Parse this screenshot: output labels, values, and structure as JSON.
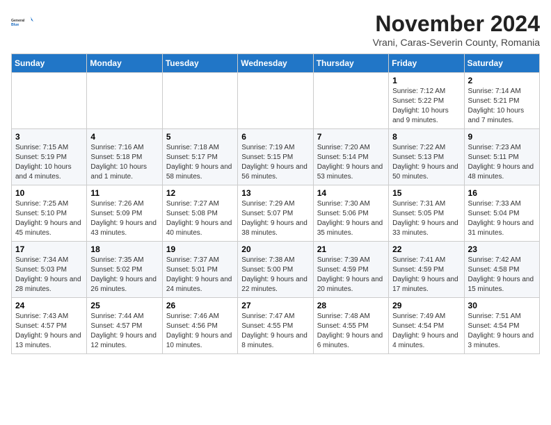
{
  "logo": {
    "general": "General",
    "blue": "Blue"
  },
  "title": "November 2024",
  "subtitle": "Vrani, Caras-Severin County, Romania",
  "days_header": [
    "Sunday",
    "Monday",
    "Tuesday",
    "Wednesday",
    "Thursday",
    "Friday",
    "Saturday"
  ],
  "weeks": [
    [
      {
        "day": "",
        "info": ""
      },
      {
        "day": "",
        "info": ""
      },
      {
        "day": "",
        "info": ""
      },
      {
        "day": "",
        "info": ""
      },
      {
        "day": "",
        "info": ""
      },
      {
        "day": "1",
        "info": "Sunrise: 7:12 AM\nSunset: 5:22 PM\nDaylight: 10 hours and 9 minutes."
      },
      {
        "day": "2",
        "info": "Sunrise: 7:14 AM\nSunset: 5:21 PM\nDaylight: 10 hours and 7 minutes."
      }
    ],
    [
      {
        "day": "3",
        "info": "Sunrise: 7:15 AM\nSunset: 5:19 PM\nDaylight: 10 hours and 4 minutes."
      },
      {
        "day": "4",
        "info": "Sunrise: 7:16 AM\nSunset: 5:18 PM\nDaylight: 10 hours and 1 minute."
      },
      {
        "day": "5",
        "info": "Sunrise: 7:18 AM\nSunset: 5:17 PM\nDaylight: 9 hours and 58 minutes."
      },
      {
        "day": "6",
        "info": "Sunrise: 7:19 AM\nSunset: 5:15 PM\nDaylight: 9 hours and 56 minutes."
      },
      {
        "day": "7",
        "info": "Sunrise: 7:20 AM\nSunset: 5:14 PM\nDaylight: 9 hours and 53 minutes."
      },
      {
        "day": "8",
        "info": "Sunrise: 7:22 AM\nSunset: 5:13 PM\nDaylight: 9 hours and 50 minutes."
      },
      {
        "day": "9",
        "info": "Sunrise: 7:23 AM\nSunset: 5:11 PM\nDaylight: 9 hours and 48 minutes."
      }
    ],
    [
      {
        "day": "10",
        "info": "Sunrise: 7:25 AM\nSunset: 5:10 PM\nDaylight: 9 hours and 45 minutes."
      },
      {
        "day": "11",
        "info": "Sunrise: 7:26 AM\nSunset: 5:09 PM\nDaylight: 9 hours and 43 minutes."
      },
      {
        "day": "12",
        "info": "Sunrise: 7:27 AM\nSunset: 5:08 PM\nDaylight: 9 hours and 40 minutes."
      },
      {
        "day": "13",
        "info": "Sunrise: 7:29 AM\nSunset: 5:07 PM\nDaylight: 9 hours and 38 minutes."
      },
      {
        "day": "14",
        "info": "Sunrise: 7:30 AM\nSunset: 5:06 PM\nDaylight: 9 hours and 35 minutes."
      },
      {
        "day": "15",
        "info": "Sunrise: 7:31 AM\nSunset: 5:05 PM\nDaylight: 9 hours and 33 minutes."
      },
      {
        "day": "16",
        "info": "Sunrise: 7:33 AM\nSunset: 5:04 PM\nDaylight: 9 hours and 31 minutes."
      }
    ],
    [
      {
        "day": "17",
        "info": "Sunrise: 7:34 AM\nSunset: 5:03 PM\nDaylight: 9 hours and 28 minutes."
      },
      {
        "day": "18",
        "info": "Sunrise: 7:35 AM\nSunset: 5:02 PM\nDaylight: 9 hours and 26 minutes."
      },
      {
        "day": "19",
        "info": "Sunrise: 7:37 AM\nSunset: 5:01 PM\nDaylight: 9 hours and 24 minutes."
      },
      {
        "day": "20",
        "info": "Sunrise: 7:38 AM\nSunset: 5:00 PM\nDaylight: 9 hours and 22 minutes."
      },
      {
        "day": "21",
        "info": "Sunrise: 7:39 AM\nSunset: 4:59 PM\nDaylight: 9 hours and 20 minutes."
      },
      {
        "day": "22",
        "info": "Sunrise: 7:41 AM\nSunset: 4:59 PM\nDaylight: 9 hours and 17 minutes."
      },
      {
        "day": "23",
        "info": "Sunrise: 7:42 AM\nSunset: 4:58 PM\nDaylight: 9 hours and 15 minutes."
      }
    ],
    [
      {
        "day": "24",
        "info": "Sunrise: 7:43 AM\nSunset: 4:57 PM\nDaylight: 9 hours and 13 minutes."
      },
      {
        "day": "25",
        "info": "Sunrise: 7:44 AM\nSunset: 4:57 PM\nDaylight: 9 hours and 12 minutes."
      },
      {
        "day": "26",
        "info": "Sunrise: 7:46 AM\nSunset: 4:56 PM\nDaylight: 9 hours and 10 minutes."
      },
      {
        "day": "27",
        "info": "Sunrise: 7:47 AM\nSunset: 4:55 PM\nDaylight: 9 hours and 8 minutes."
      },
      {
        "day": "28",
        "info": "Sunrise: 7:48 AM\nSunset: 4:55 PM\nDaylight: 9 hours and 6 minutes."
      },
      {
        "day": "29",
        "info": "Sunrise: 7:49 AM\nSunset: 4:54 PM\nDaylight: 9 hours and 4 minutes."
      },
      {
        "day": "30",
        "info": "Sunrise: 7:51 AM\nSunset: 4:54 PM\nDaylight: 9 hours and 3 minutes."
      }
    ]
  ]
}
